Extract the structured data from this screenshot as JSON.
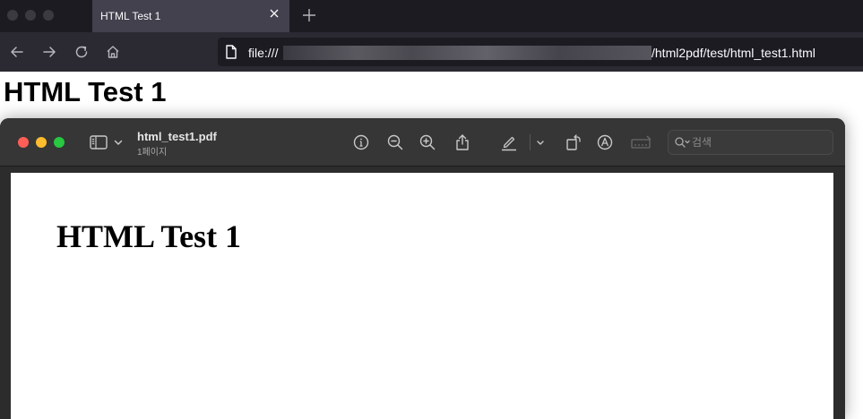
{
  "browser": {
    "tab": {
      "title": "HTML Test 1"
    },
    "url": {
      "prefix": "file:///",
      "suffix": "/html2pdf/test/html_test1.html"
    }
  },
  "page": {
    "heading": "HTML Test 1"
  },
  "preview": {
    "filename": "html_test1.pdf",
    "page_count": "1페이지",
    "search": {
      "placeholder": "검색"
    },
    "document": {
      "heading": "HTML Test 1"
    },
    "colors": {
      "close": "#ff5f57",
      "minimize": "#febc2e",
      "zoom": "#28c840"
    }
  }
}
